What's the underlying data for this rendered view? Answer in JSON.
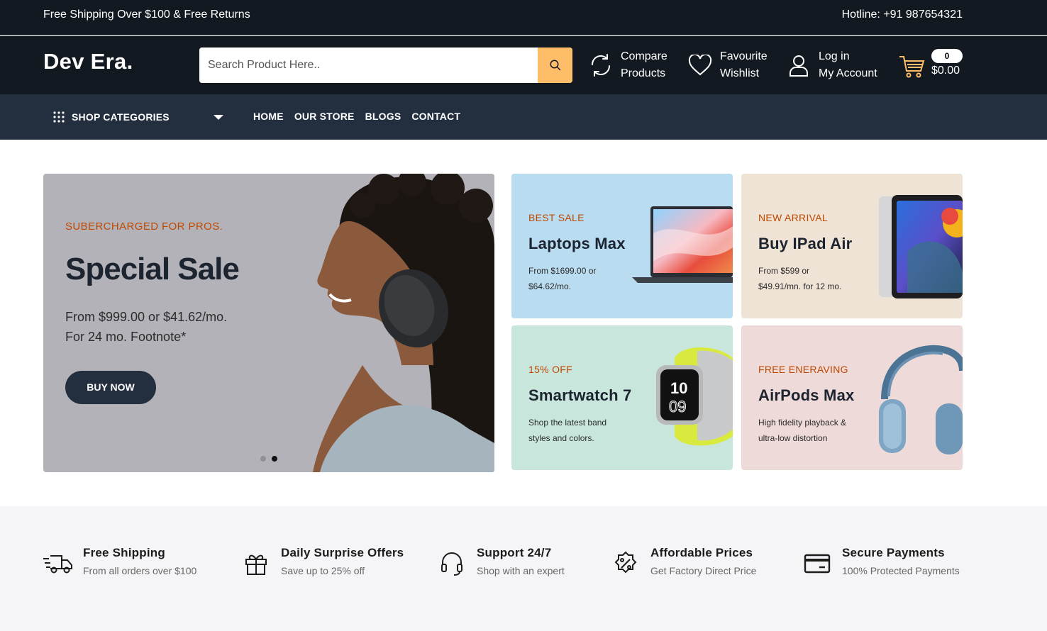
{
  "topbar": {
    "left": "Free Shipping Over $100 & Free Returns",
    "right": "Hotline: +91 987654321"
  },
  "header": {
    "logo": "Dev Era.",
    "search_placeholder": "Search Product Here..",
    "compare": [
      "Compare",
      "Products"
    ],
    "wishlist": [
      "Favourite",
      "Wishlist"
    ],
    "account": [
      "Log in",
      "My Account"
    ],
    "cart_count": "0",
    "cart_total": "$0.00"
  },
  "nav": {
    "categories": "SHOP CATEGORIES",
    "links": [
      "HOME",
      "OUR STORE",
      "BLOGS",
      "CONTACT"
    ]
  },
  "hero": {
    "eyebrow": "SUBERCHARGED FOR PROS.",
    "title": "Special Sale",
    "line1": "From $999.00 or $41.62/mo.",
    "line2": "For 24 mo. Footnote*",
    "button": "BUY NOW",
    "slides": 2,
    "active_slide": 2
  },
  "cards": [
    {
      "tag": "BEST SALE",
      "title": "Laptops Max",
      "line1": "From $1699.00 or",
      "line2": "$64.62/mo.",
      "bg": "#b9dcf0"
    },
    {
      "tag": "NEW ARRIVAL",
      "title": "Buy IPad Air",
      "line1": "From $599 or",
      "line2": "$49.91/mn. for 12 mo.",
      "bg": "#efe3d5"
    },
    {
      "tag": "15% OFF",
      "title": "Smartwatch 7",
      "line1": "Shop the latest band",
      "line2": "styles and colors.",
      "bg": "#c9e6dd"
    },
    {
      "tag": "FREE ENERAVING",
      "title": "AirPods Max",
      "line1": "High fidelity playback &",
      "line2": "ultra-low distortion",
      "bg": "#eedad9"
    }
  ],
  "services": [
    {
      "icon": "truck-icon",
      "title": "Free Shipping",
      "sub": "From all orders over $100"
    },
    {
      "icon": "gift-icon",
      "title": "Daily Surprise Offers",
      "sub": "Save up to 25% off"
    },
    {
      "icon": "headset-icon",
      "title": "Support 24/7",
      "sub": "Shop with an expert"
    },
    {
      "icon": "discount-badge-icon",
      "title": "Affordable Prices",
      "sub": "Get Factory Direct Price"
    },
    {
      "icon": "credit-card-icon",
      "title": "Secure Payments",
      "sub": "100% Protected Payments"
    }
  ],
  "colors": {
    "header_bg": "#131921",
    "nav_bg": "#232f3e",
    "search_button": "#febd69",
    "accent_text": "#bf4800",
    "services_bg": "#f5f5f7"
  }
}
